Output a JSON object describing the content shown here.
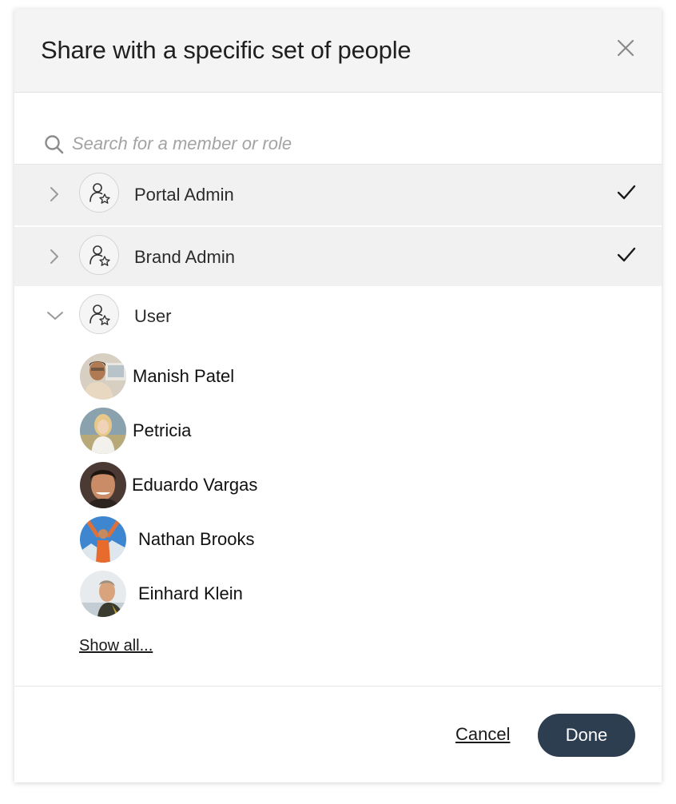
{
  "dialog": {
    "title": "Share with a specific set of people",
    "close_icon": "close-icon"
  },
  "search": {
    "placeholder": "Search for a member or role",
    "value": "",
    "icon": "search-icon"
  },
  "roles": [
    {
      "label": "Portal Admin",
      "expanded": false,
      "selected": true,
      "icon": "user-star-icon"
    },
    {
      "label": "Brand Admin",
      "expanded": false,
      "selected": true,
      "icon": "user-star-icon"
    },
    {
      "label": "User",
      "expanded": true,
      "selected": false,
      "icon": "user-star-icon"
    }
  ],
  "members": [
    {
      "name": "Manish Patel"
    },
    {
      "name": "Petricia"
    },
    {
      "name": "Eduardo Vargas"
    },
    {
      "name": "Nathan Brooks"
    },
    {
      "name": "Einhard Klein"
    }
  ],
  "show_all_label": "Show all...",
  "footer": {
    "cancel_label": "Cancel",
    "done_label": "Done"
  },
  "colors": {
    "primary_button": "#2c3e50",
    "header_bg": "#f4f4f4",
    "selected_row_bg": "#f1f1f1"
  }
}
